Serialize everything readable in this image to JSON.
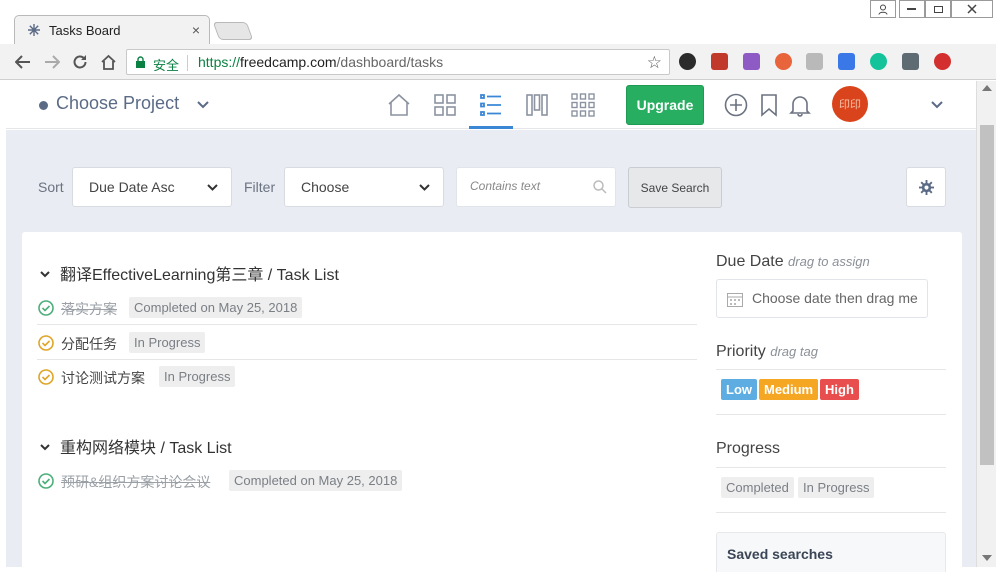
{
  "browser": {
    "tab_title": "Tasks Board",
    "tab_close": "×",
    "secure_label": "安全",
    "url_scheme": "https://",
    "url_host": "freedcamp.com",
    "url_path": "/dashboard/tasks"
  },
  "header": {
    "project_title": "Choose Project",
    "upgrade_label": "Upgrade",
    "avatar_text": "印印"
  },
  "filters": {
    "sort_label": "Sort",
    "sort_value": "Due Date Asc",
    "filter_label": "Filter",
    "filter_value": "Choose",
    "search_placeholder": "Contains text",
    "save_search_label": "Save Search"
  },
  "lists": [
    {
      "title": "翻译EffectiveLearning第三章 / Task List",
      "tasks": [
        {
          "name": "落实方案",
          "status": "Completed on May 25, 2018",
          "done": true
        },
        {
          "name": "分配任务",
          "status": "In Progress",
          "done": false
        },
        {
          "name": "讨论测试方案",
          "status": "In Progress",
          "done": false
        }
      ]
    },
    {
      "title": "重构网络模块 / Task List",
      "tasks": [
        {
          "name": "预研&组织方案讨论会议",
          "status": "Completed on May 25, 2018",
          "done": true
        }
      ]
    }
  ],
  "sidebar": {
    "due_date_title": "Due Date",
    "due_date_hint": "drag to assign",
    "date_placeholder": "Choose date then drag me",
    "priority_title": "Priority",
    "priority_hint": "drag tag",
    "priority_tags": [
      {
        "label": "Low",
        "color": "#5dade2"
      },
      {
        "label": "Medium",
        "color": "#f5a623"
      },
      {
        "label": "High",
        "color": "#e94e4e"
      }
    ],
    "progress_title": "Progress",
    "progress_tags": [
      "Completed",
      "In Progress"
    ],
    "saved_searches_title": "Saved searches"
  },
  "colors": {
    "accent": "#3a87d6",
    "upgrade": "#27ae60",
    "done_check": "#4caf7a",
    "progress_check": "#e0a526",
    "avatar": "#d9441c"
  }
}
